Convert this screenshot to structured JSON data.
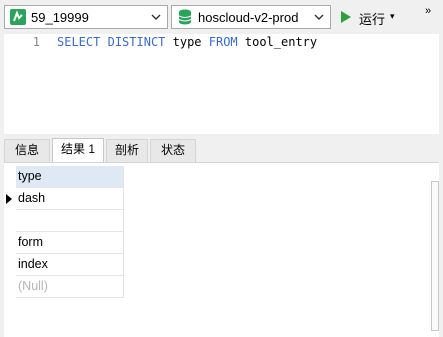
{
  "toolbar": {
    "connection": {
      "label": "59_19999",
      "icon": "connection-icon"
    },
    "database": {
      "label": "hoscloud-v2-prod",
      "icon": "database-icon"
    },
    "run": {
      "label": "运行",
      "icon": "run-icon",
      "arrow": "▾"
    },
    "more": "»"
  },
  "editor": {
    "line_number": "1",
    "code": [
      "SELECT",
      " ",
      "DISTINCT",
      " type ",
      "FROM",
      " tool_entry"
    ]
  },
  "tabs": [
    {
      "label": "信息"
    },
    {
      "label": "结果 1",
      "active": true
    },
    {
      "label": "剖析"
    },
    {
      "label": "状态"
    }
  ],
  "result": {
    "header": "type",
    "rows": [
      "dash",
      "",
      "form",
      "index",
      "(Null)"
    ]
  },
  "colors": {
    "run_green": "#2ea043",
    "keyword_blue": "#3b6bc9",
    "header_bg": "#dfe8f5"
  }
}
